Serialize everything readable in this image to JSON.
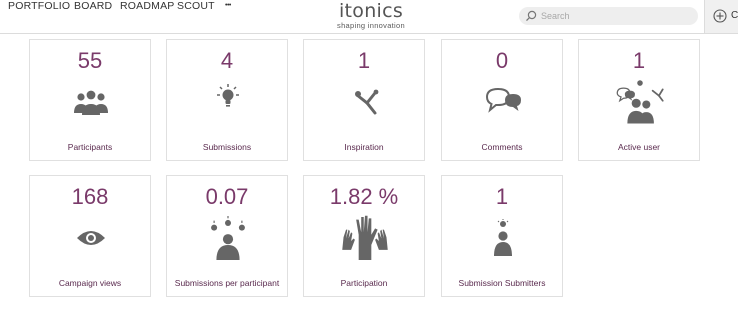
{
  "nav": {
    "items": [
      "PORTFOLIO",
      "BOARD",
      "ROADMAP",
      "SCOUT"
    ],
    "more": "•••"
  },
  "logo": {
    "word": "itonics",
    "tagline": "shaping innovation"
  },
  "search": {
    "placeholder": "Search"
  },
  "create": {
    "label": "CI"
  },
  "stats": [
    {
      "value": "55",
      "label": "Participants",
      "icon": "participants-group-icon"
    },
    {
      "value": "4",
      "label": "Submissions",
      "icon": "idea-submission-icon"
    },
    {
      "value": "1",
      "label": "Inspiration",
      "icon": "inspiration-icon"
    },
    {
      "value": "0",
      "label": "Comments",
      "icon": "comments-icon"
    },
    {
      "value": "1",
      "label": "Active user",
      "icon": "active-user-icon"
    },
    {
      "value": "168",
      "label": "Campaign views",
      "icon": "eye-icon"
    },
    {
      "value": "0.07",
      "label": "Submissions per participant",
      "icon": "submissions-per-participant-icon"
    },
    {
      "value": "1.82 %",
      "label": "Participation",
      "icon": "raised-hands-icon"
    },
    {
      "value": "1",
      "label": "Submission Submitters",
      "icon": "submission-submitter-icon"
    }
  ],
  "colors": {
    "value": "#7a3a6a",
    "label": "#5a2a4e",
    "icon": "#666666"
  }
}
